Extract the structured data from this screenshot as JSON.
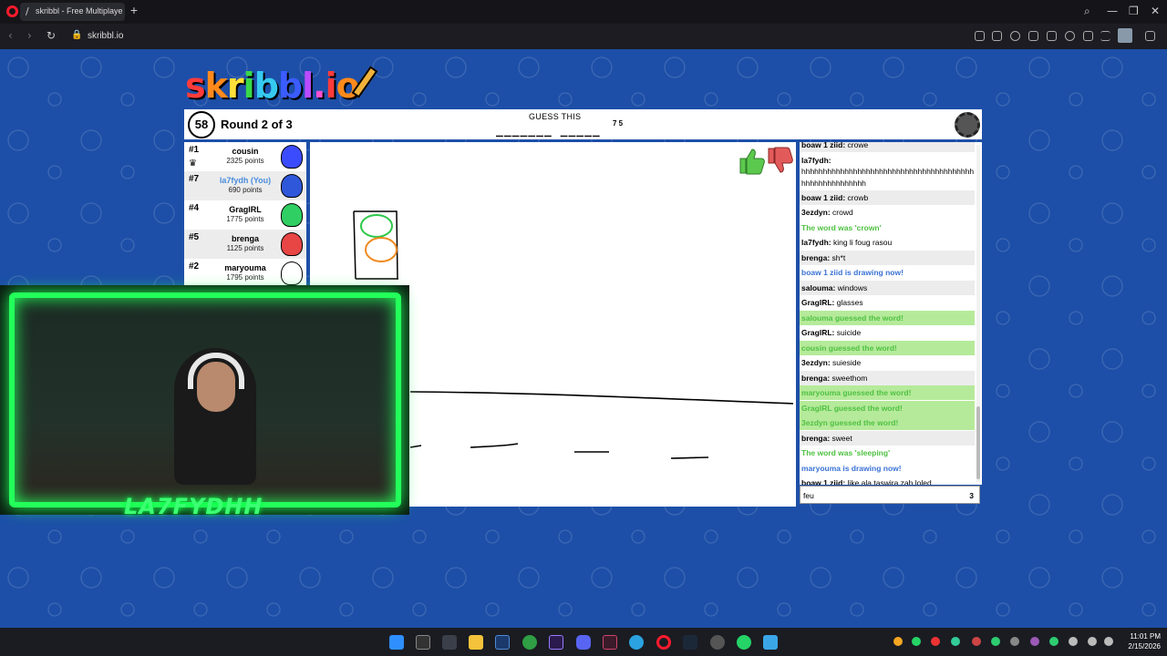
{
  "browser": {
    "tab_title": "skribbl - Free Multiplayer",
    "tab_favicon": "/",
    "new_tab_label": "+",
    "url": "skribbl.io",
    "back_icon": "‹",
    "forward_icon": "›",
    "reload_icon": "↻",
    "search_icon": "⌕",
    "minimize_icon": "—",
    "maximize_icon": "❐",
    "close_icon": "✕"
  },
  "logo": {
    "letters": [
      "s",
      "k",
      "r",
      "i",
      "b",
      "b",
      "l",
      ".",
      "i",
      "o"
    ],
    "colors": [
      "#ff3b3b",
      "#ff8a1c",
      "#ffe03a",
      "#39d84a",
      "#36c9f0",
      "#3b5cff",
      "#b94bff",
      "#ff4fd0",
      "#ff3b3b",
      "#ff8a1c"
    ]
  },
  "game": {
    "timer": "58",
    "round": "Round 2 of 3",
    "guess_label": "GUESS THIS",
    "word_blanks": "_______ _____",
    "word_lengths": "7 5"
  },
  "players": [
    {
      "rank": "#1",
      "name": "cousin",
      "points": "2325 points",
      "color": "#3b4cff",
      "you": false,
      "crown": true
    },
    {
      "rank": "#7",
      "name": "la7fydh (You)",
      "points": "690 points",
      "color": "#2f57d9",
      "you": true,
      "crown": false
    },
    {
      "rank": "#4",
      "name": "GraglRL",
      "points": "1775 points",
      "color": "#2fcf63",
      "you": false,
      "crown": false
    },
    {
      "rank": "#5",
      "name": "brenga",
      "points": "1125 points",
      "color": "#e84545",
      "you": false,
      "crown": false
    },
    {
      "rank": "#2",
      "name": "maryouma",
      "points": "1795 points",
      "color": "#ffffff",
      "you": false,
      "crown": false
    }
  ],
  "chat": [
    {
      "user": "boaw 1 ziid:",
      "text": "crowe",
      "style": "plain"
    },
    {
      "user": "la7fydh:",
      "text": "hhhhhhhhhhhhhhhhhhhhhhhhhhhhhhhhhhhhhhhhhhhhhhhhhhhhhhh",
      "style": "plain"
    },
    {
      "user": "boaw 1 ziid:",
      "text": "crowb",
      "style": "plain"
    },
    {
      "user": "3ezdyn:",
      "text": "crowd",
      "style": "plain"
    },
    {
      "user": "",
      "text": "The word was 'crown'",
      "style": "green"
    },
    {
      "user": "la7fydh:",
      "text": "king li foug rasou",
      "style": "plain"
    },
    {
      "user": "brenga:",
      "text": "sh*t",
      "style": "plain"
    },
    {
      "user": "",
      "text": "boaw 1 ziid is drawing now!",
      "style": "blue"
    },
    {
      "user": "salouma:",
      "text": "windows",
      "style": "plain"
    },
    {
      "user": "GraglRL:",
      "text": "glasses",
      "style": "plain"
    },
    {
      "user": "",
      "text": "salouma guessed the word!",
      "style": "greenbg"
    },
    {
      "user": "GraglRL:",
      "text": "suicide",
      "style": "plain"
    },
    {
      "user": "",
      "text": "cousin guessed the word!",
      "style": "greenbg"
    },
    {
      "user": "3ezdyn:",
      "text": "suieside",
      "style": "plain"
    },
    {
      "user": "brenga:",
      "text": "sweethom",
      "style": "plain"
    },
    {
      "user": "",
      "text": "maryouma guessed the word!",
      "style": "greenbg"
    },
    {
      "user": "",
      "text": "GraglRL guessed the word!",
      "style": "greenbg"
    },
    {
      "user": "",
      "text": "3ezdyn guessed the word!",
      "style": "greenbg"
    },
    {
      "user": "brenga:",
      "text": "sweet",
      "style": "plain"
    },
    {
      "user": "",
      "text": "The word was 'sleeping'",
      "style": "green"
    },
    {
      "user": "",
      "text": "maryouma is drawing now!",
      "style": "blue"
    },
    {
      "user": "boaw 1 ziid:",
      "text": "like ala taswira zah loled",
      "style": "plain"
    }
  ],
  "chat_input": {
    "value": "feu",
    "count": "3"
  },
  "webcam": {
    "overlay_name": "LA7FYDHH"
  },
  "thumbs": {
    "up_icon": "thumbs-up-icon",
    "down_icon": "thumbs-down-icon"
  },
  "taskbar": {
    "time": "11:01 PM",
    "date": "2/15/2026"
  }
}
